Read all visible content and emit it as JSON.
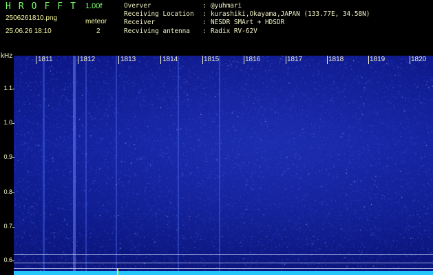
{
  "header": {
    "app_title": "HROFFT",
    "version": "1.00f",
    "filename": "2506261810.png",
    "datetime": "25.06.26 18:10",
    "mode": "meteor",
    "count": "2"
  },
  "info": [
    {
      "key": "Overver",
      "sep": ":",
      "value": "@yuhmari"
    },
    {
      "key": "Receiving Location",
      "sep": ":",
      "value": "kurashiki,Okayama,JAPAN (133.77E, 34.58N)"
    },
    {
      "key": "Receiver",
      "sep": ":",
      "value": "NESDR SMArt + HDSDR"
    },
    {
      "key": "Recviving antenna",
      "sep": ":",
      "value": "Radix RV-62V"
    }
  ],
  "axis": {
    "freq_unit": "kHz",
    "freq_labels": [
      "1.1",
      "1.0",
      "0.9",
      "0.8",
      "0.7",
      "0.6"
    ],
    "time_labels": [
      "1811",
      "1812",
      "1813",
      "1814",
      "1815",
      "1816",
      "1817",
      "1818",
      "1819",
      "1820"
    ]
  },
  "colors": {
    "title": "#7cff6a",
    "text": "#f2f2c8",
    "background": "#000000",
    "spectrum_base": "#0f1c8f",
    "baseline": "#25c6ff",
    "peak": "#ffe23a"
  }
}
